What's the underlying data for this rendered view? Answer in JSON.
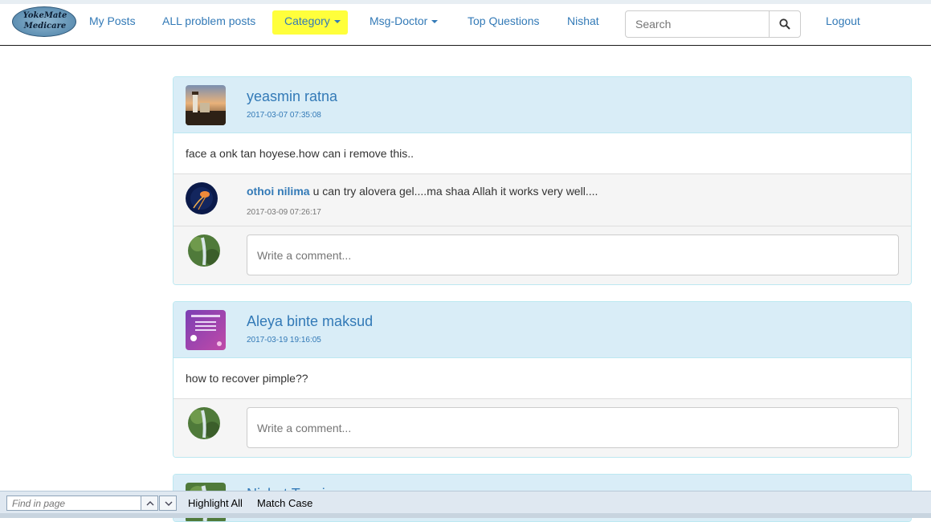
{
  "navbar": {
    "logo_line1": "YokeMate",
    "logo_line2": "Medicare",
    "links": {
      "my_posts": "My Posts",
      "all_problem_posts": "ALL problem posts",
      "category": "Category",
      "msg_doctor": "Msg-Doctor",
      "top_questions": "Top Questions",
      "user": "Nishat",
      "logout": "Logout"
    },
    "search_placeholder": "Search",
    "highlight_color": "#ffff3b",
    "link_color": "#337ab7"
  },
  "posts": [
    {
      "author": "yeasmin ratna",
      "time": "2017-03-07 07:35:08",
      "body": "face a onk tan hoyese.how can i remove this..",
      "comments": [
        {
          "author": "othoi nilima",
          "text": "u can try alovera gel....ma shaa Allah it works very well....",
          "time": "2017-03-09 07:26:17"
        }
      ],
      "comment_placeholder": "Write a comment..."
    },
    {
      "author": "Aleya binte maksud",
      "time": "2017-03-19 19:16:05",
      "body": "how to recover pimple??",
      "comments": [],
      "comment_placeholder": "Write a comment..."
    },
    {
      "author": "Nishat Tasnim"
    }
  ],
  "findbar": {
    "placeholder": "Find in page",
    "highlight_all": "Highlight All",
    "match_case": "Match Case"
  },
  "panel_header_color": "#d9edf7"
}
